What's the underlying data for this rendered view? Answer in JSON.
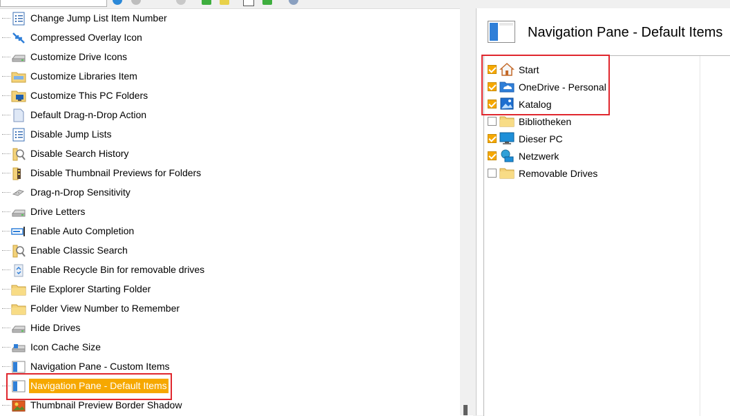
{
  "tree": {
    "items": [
      {
        "label": "Change Jump List Item Number",
        "icon": "list-doc-icon"
      },
      {
        "label": "Compressed Overlay Icon",
        "icon": "compress-arrows-icon"
      },
      {
        "label": "Customize Drive Icons",
        "icon": "drive-icon"
      },
      {
        "label": "Customize Libraries Item",
        "icon": "library-folder-icon"
      },
      {
        "label": "Customize This PC Folders",
        "icon": "pc-folder-icon"
      },
      {
        "label": "Default Drag-n-Drop Action",
        "icon": "document-icon"
      },
      {
        "label": "Disable Jump Lists",
        "icon": "list-doc-icon"
      },
      {
        "label": "Disable Search History",
        "icon": "search-folder-icon"
      },
      {
        "label": "Disable Thumbnail Previews for Folders",
        "icon": "folder-zipper-icon"
      },
      {
        "label": "Drag-n-Drop Sensitivity",
        "icon": "drag-icon"
      },
      {
        "label": "Drive Letters",
        "icon": "drive-icon"
      },
      {
        "label": "Enable Auto Completion",
        "icon": "textbox-icon"
      },
      {
        "label": "Enable Classic Search",
        "icon": "search-folder-icon"
      },
      {
        "label": "Enable Recycle Bin for removable drives",
        "icon": "recycle-bin-icon"
      },
      {
        "label": "File Explorer Starting Folder",
        "icon": "folder-icon"
      },
      {
        "label": "Folder View Number to Remember",
        "icon": "folder-icon"
      },
      {
        "label": "Hide Drives",
        "icon": "drive-icon"
      },
      {
        "label": "Icon Cache Size",
        "icon": "drive-cache-icon"
      },
      {
        "label": "Navigation Pane - Custom Items",
        "icon": "nav-pane-icon"
      },
      {
        "label": "Navigation Pane - Default Items",
        "icon": "nav-pane-icon"
      },
      {
        "label": "Thumbnail Preview Border Shadow",
        "icon": "picture-icon"
      }
    ],
    "selected_index": 19
  },
  "detail": {
    "title": "Navigation Pane - Default Items",
    "title_icon": "nav-pane-icon",
    "items": [
      {
        "label": "Start",
        "checked": true,
        "icon": "home-icon"
      },
      {
        "label": "OneDrive - Personal",
        "checked": true,
        "icon": "cloud-folder-icon"
      },
      {
        "label": "Katalog",
        "checked": true,
        "icon": "gallery-icon"
      },
      {
        "label": "Bibliotheken",
        "checked": false,
        "icon": "folder-icon"
      },
      {
        "label": "Dieser PC",
        "checked": true,
        "icon": "monitor-icon"
      },
      {
        "label": "Netzwerk",
        "checked": true,
        "icon": "network-icon"
      },
      {
        "label": "Removable Drives",
        "checked": false,
        "icon": "folder-icon"
      }
    ]
  },
  "colors": {
    "selection": "#f6a800",
    "annotation": "#e0262d",
    "checkbox_checked": "#f6a800"
  }
}
